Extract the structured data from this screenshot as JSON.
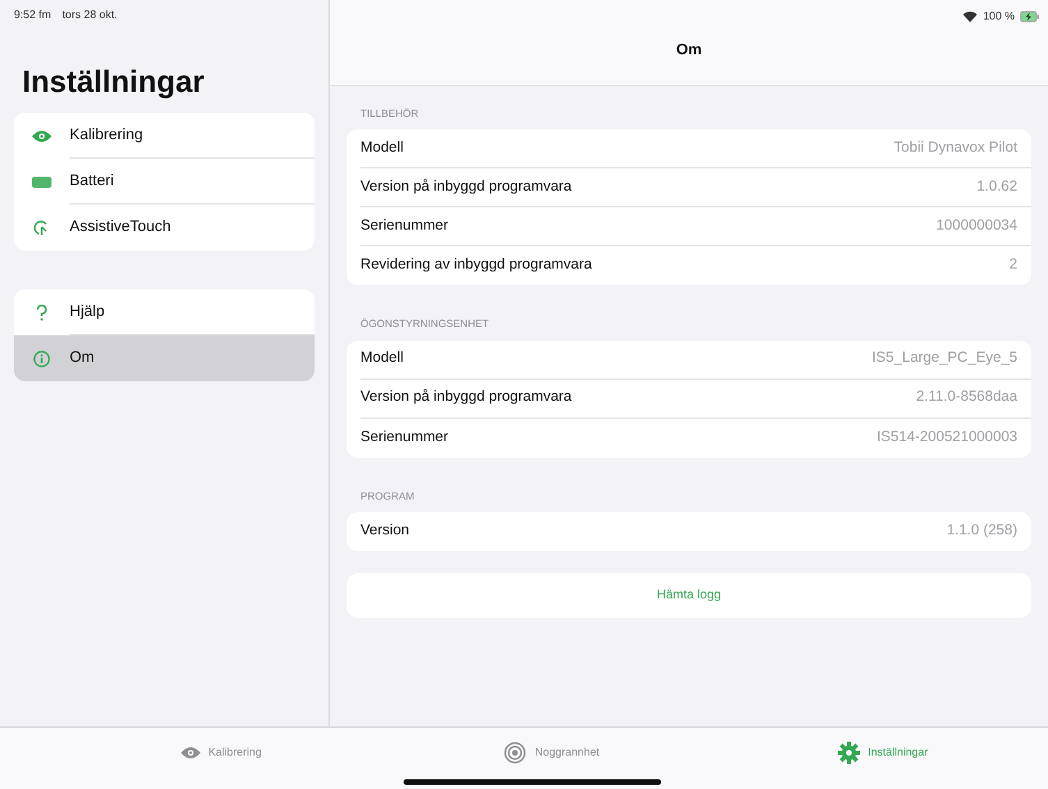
{
  "status_bar": {
    "time": "9:52 fm",
    "date": "tors 28 okt.",
    "battery": "100 %",
    "charging": true
  },
  "sidebar": {
    "title": "Inställningar",
    "groups": [
      {
        "items": [
          {
            "label": "Kalibrering",
            "kind": "eye",
            "selected": false
          },
          {
            "label": "Batteri",
            "kind": "battery",
            "selected": false
          },
          {
            "label": "AssistiveTouch",
            "kind": "touch",
            "selected": false
          }
        ]
      },
      {
        "items": [
          {
            "label": "Hjälp",
            "kind": "help",
            "selected": false
          },
          {
            "label": "Om",
            "kind": "info",
            "selected": true
          }
        ]
      }
    ]
  },
  "detail": {
    "title": "Om",
    "sections": [
      {
        "header": "TILLBEHÖR",
        "rows": [
          {
            "label": "Modell",
            "value": "Tobii Dynavox Pilot"
          },
          {
            "label": "Version på inbyggd programvara",
            "value": "1.0.62"
          },
          {
            "label": "Serienummer",
            "value": "1000000034"
          },
          {
            "label": "Revidering av inbyggd programvara",
            "value": "2"
          }
        ]
      },
      {
        "header": "ÖGONSTYRNINGSENHET",
        "rows": [
          {
            "label": "Modell",
            "value": "IS5_Large_PC_Eye_5"
          },
          {
            "label": "Version på inbyggd programvara",
            "value": "2.11.0-8568daa"
          },
          {
            "label": "Serienummer",
            "value": "IS514-200521000003"
          }
        ]
      },
      {
        "header": "PROGRAM",
        "rows": [
          {
            "label": "Version",
            "value": "1.1.0 (258)"
          }
        ]
      }
    ],
    "button": "Hämta logg"
  },
  "tab_bar": [
    {
      "label": "Kalibrering",
      "kind": "eye",
      "selected": false
    },
    {
      "label": "Noggrannhet",
      "kind": "target",
      "selected": false
    },
    {
      "label": "Inställningar",
      "kind": "gear",
      "selected": true
    }
  ]
}
